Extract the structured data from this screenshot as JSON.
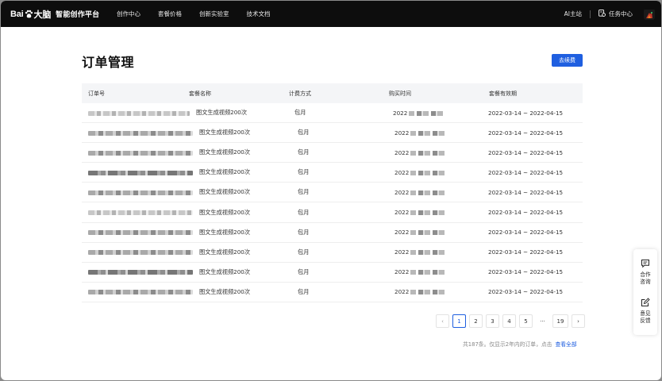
{
  "header": {
    "logo_text_left": "Bai",
    "logo_text_right": "大脑",
    "platform_name": "智能创作平台",
    "nav": [
      {
        "label": "创作中心"
      },
      {
        "label": "套餐价格"
      },
      {
        "label": "创新实验室"
      },
      {
        "label": "技术文档"
      }
    ],
    "ai_home": "AI主站",
    "task_center": "任务中心"
  },
  "main": {
    "title": "订单管理",
    "renew_button": "去续费"
  },
  "table": {
    "columns": [
      "订单号",
      "套餐名称",
      "计费方式",
      "购买时间",
      "套餐有效期"
    ],
    "rows": [
      {
        "package": "图文生成视频200次",
        "billing": "包月",
        "purchase_prefix": "2022",
        "validity": "2022-03-14 ~ 2022-04-15"
      },
      {
        "package": "图文生成视频200次",
        "billing": "包月",
        "purchase_prefix": "2022",
        "validity": "2022-03-14 ~ 2022-04-15"
      },
      {
        "package": "图文生成视频200次",
        "billing": "包月",
        "purchase_prefix": "2022",
        "validity": "2022-03-14 ~ 2022-04-15"
      },
      {
        "package": "图文生成视频200次",
        "billing": "包月",
        "purchase_prefix": "2022",
        "validity": "2022-03-14 ~ 2022-04-15"
      },
      {
        "package": "图文生成视频200次",
        "billing": "包月",
        "purchase_prefix": "2022",
        "validity": "2022-03-14 ~ 2022-04-15"
      },
      {
        "package": "图文生成视频200次",
        "billing": "包月",
        "purchase_prefix": "2022",
        "validity": "2022-03-14 ~ 2022-04-15"
      },
      {
        "package": "图文生成视频200次",
        "billing": "包月",
        "purchase_prefix": "2022",
        "validity": "2022-03-14 ~ 2022-04-15"
      },
      {
        "package": "图文生成视频200次",
        "billing": "包月",
        "purchase_prefix": "2022",
        "validity": "2022-03-14 ~ 2022-04-15"
      },
      {
        "package": "图文生成视频200次",
        "billing": "包月",
        "purchase_prefix": "2022",
        "validity": "2022-03-14 ~ 2022-04-15"
      },
      {
        "package": "图文生成视频200次",
        "billing": "包月",
        "purchase_prefix": "2022",
        "validity": "2022-03-14 ~ 2022-04-15"
      }
    ]
  },
  "pagination": {
    "prev_icon": "chevron-left-icon",
    "next_icon": "chevron-right-icon",
    "pages": [
      "1",
      "2",
      "3",
      "4",
      "5"
    ],
    "ellipsis": "···",
    "last_page": "19",
    "current": "1"
  },
  "footer": {
    "note": "共187条。仅显示2年内的订单，点击",
    "view_all": "查看全部"
  },
  "side_widget": {
    "cooperate_line1": "合作",
    "cooperate_line2": "咨询",
    "feedback_line1": "意见",
    "feedback_line2": "反馈"
  },
  "colors": {
    "topbar": "#0d0d0d",
    "accent": "#1f5fe0",
    "table_header_bg": "#f4f5f7"
  }
}
